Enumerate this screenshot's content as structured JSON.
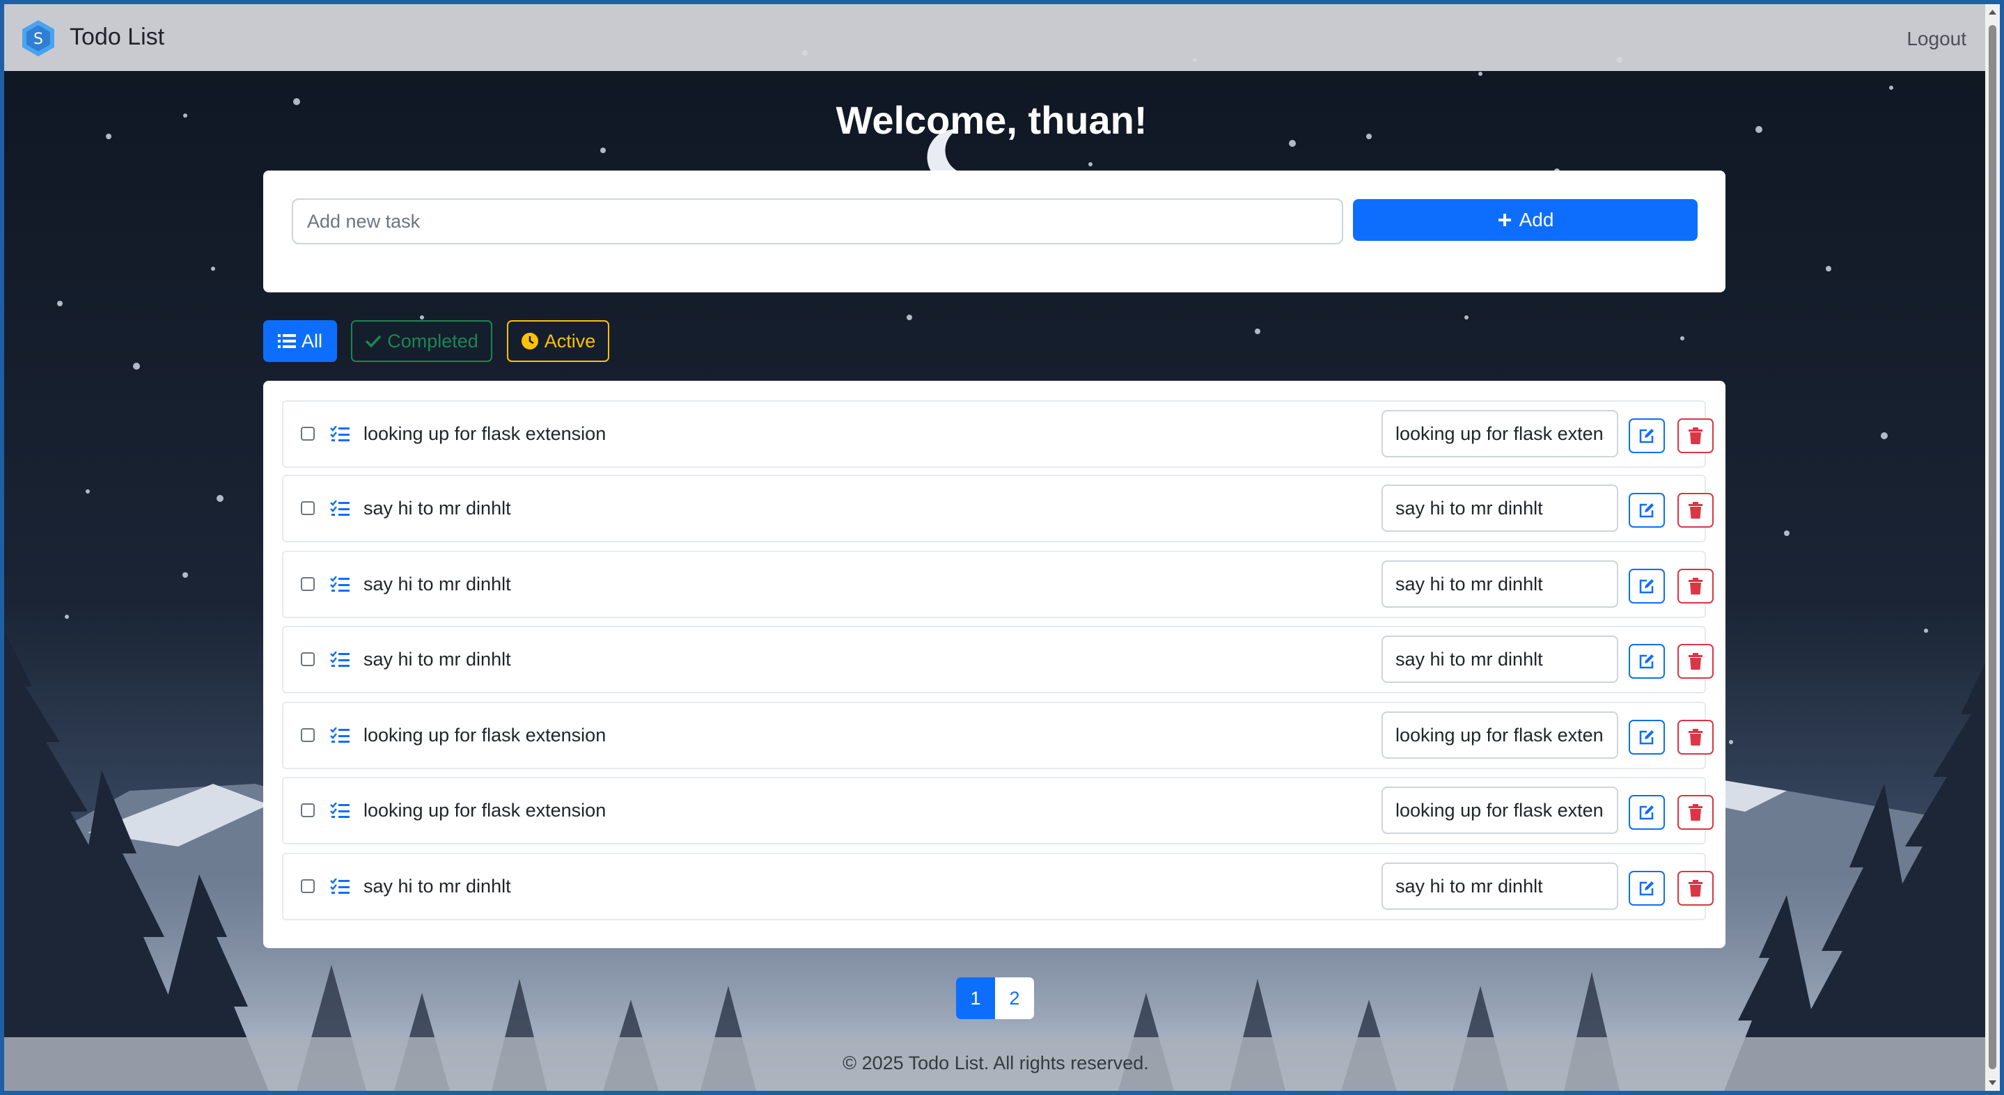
{
  "app": {
    "title": "Todo List",
    "logout_label": "Logout",
    "logo_icon": "app-logo-icon"
  },
  "welcome": "Welcome, thuan!",
  "add_form": {
    "placeholder": "Add new task",
    "value": "",
    "add_label": "Add"
  },
  "filters": {
    "all": "All",
    "completed": "Completed",
    "active": "Active",
    "selected": "All"
  },
  "tasks": [
    {
      "text": "looking up for flask extension",
      "edit_value": "looking up for flask extension",
      "checked": false
    },
    {
      "text": "say hi to mr dinhlt",
      "edit_value": "say hi to mr dinhlt",
      "checked": false
    },
    {
      "text": "say hi to mr dinhlt",
      "edit_value": "say hi to mr dinhlt",
      "checked": false
    },
    {
      "text": "say hi to mr dinhlt",
      "edit_value": "say hi to mr dinhlt",
      "checked": false
    },
    {
      "text": "looking up for flask extension",
      "edit_value": "looking up for flask extension",
      "checked": false
    },
    {
      "text": "looking up for flask extension",
      "edit_value": "looking up for flask extension",
      "checked": false
    },
    {
      "text": "say hi to mr dinhlt",
      "edit_value": "say hi to mr dinhlt",
      "checked": false
    }
  ],
  "pagination": {
    "pages": [
      "1",
      "2"
    ],
    "current": "1"
  },
  "footer": "© 2025 Todo List. All rights reserved.",
  "colors": {
    "primary": "#0d6efd",
    "success": "#198754",
    "warning": "#ffc107",
    "danger": "#dc3545"
  }
}
